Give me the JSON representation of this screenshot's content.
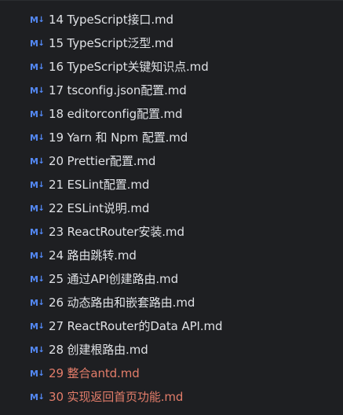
{
  "project_tree": {
    "icon": "markdown-icon",
    "icon_glyph_m": "M",
    "icon_glyph_arrow": "↓",
    "colors": {
      "background": "#1e1f22",
      "text": "#dfe1e5",
      "modified_text": "#e37d6a",
      "markdown_icon": "#548af7"
    },
    "files": [
      {
        "label": "14 TypeScript接口.md",
        "status": "normal"
      },
      {
        "label": "15 TypeScript泛型.md",
        "status": "normal"
      },
      {
        "label": "16 TypeScript关键知识点.md",
        "status": "normal"
      },
      {
        "label": "17 tsconfig.json配置.md",
        "status": "normal"
      },
      {
        "label": "18 editorconfig配置.md",
        "status": "normal"
      },
      {
        "label": "19 Yarn 和 Npm 配置.md",
        "status": "normal"
      },
      {
        "label": "20 Prettier配置.md",
        "status": "normal"
      },
      {
        "label": "21 ESLint配置.md",
        "status": "normal"
      },
      {
        "label": "22 ESLint说明.md",
        "status": "normal"
      },
      {
        "label": "23 ReactRouter安装.md",
        "status": "normal"
      },
      {
        "label": "24 路由跳转.md",
        "status": "normal"
      },
      {
        "label": "25 通过API创建路由.md",
        "status": "normal"
      },
      {
        "label": "26 动态路由和嵌套路由.md",
        "status": "normal"
      },
      {
        "label": "27 ReactRouter的Data API.md",
        "status": "normal"
      },
      {
        "label": "28 创建根路由.md",
        "status": "normal"
      },
      {
        "label": "29 整合antd.md",
        "status": "modified"
      },
      {
        "label": "30 实现返回首页功能.md",
        "status": "modified"
      }
    ]
  }
}
